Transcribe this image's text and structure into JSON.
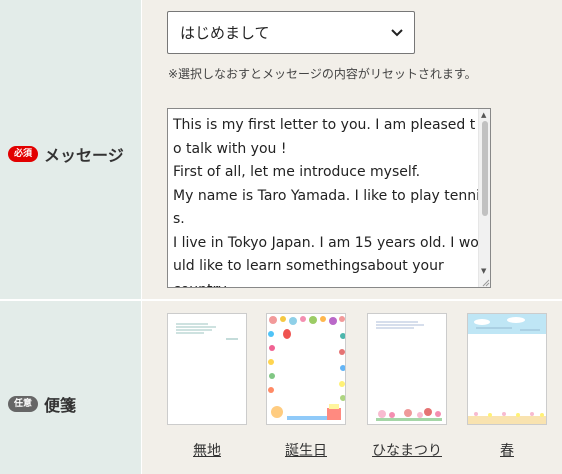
{
  "greeting_select": {
    "value": "はじめまして"
  },
  "reset_note": "※選択しなおすとメッセージの内容がリセットされます。",
  "message": {
    "badge": "必須",
    "label": "メッセージ",
    "text": "This is my first letter to you. I am pleased to talk with you !\nFirst of all, let me introduce myself.\nMy name is Taro Yamada. I like to play tennis.\nI live in Tokyo Japan. I am 15 years old. I would like to learn somethingsabout your\ncountry"
  },
  "stationery": {
    "badge": "任意",
    "label": "便箋",
    "options": [
      {
        "label": "無地"
      },
      {
        "label": "誕生日"
      },
      {
        "label": "ひなまつり"
      },
      {
        "label": "春"
      }
    ]
  },
  "colors": {
    "required_badge": "#e20000",
    "optional_badge": "#666666",
    "label_bg": "#e3ece9",
    "content_bg": "#f2efe9"
  }
}
